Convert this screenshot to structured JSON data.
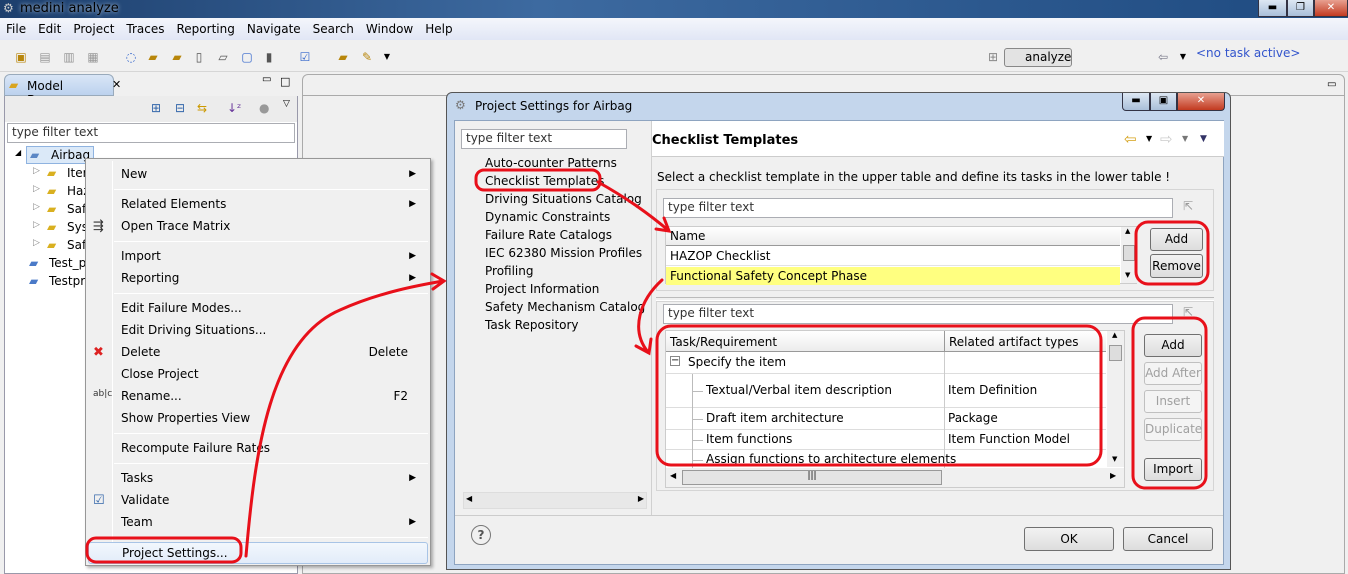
{
  "window": {
    "title": "medini analyze"
  },
  "menubar": [
    "File",
    "Edit",
    "Project",
    "Traces",
    "Reporting",
    "Navigate",
    "Search",
    "Window",
    "Help"
  ],
  "perspective": {
    "label": "analyze",
    "task": "<no task active>"
  },
  "model_browser": {
    "title": "Model Browser",
    "filter_placeholder": "type filter text",
    "tree": [
      {
        "label": "Airbag",
        "level": 0
      },
      {
        "label": "Iter",
        "level": 1
      },
      {
        "label": "Haz",
        "level": 1
      },
      {
        "label": "Saf",
        "level": 1
      },
      {
        "label": "Sys",
        "level": 1
      },
      {
        "label": "Saf",
        "level": 1
      },
      {
        "label": "Test_pr",
        "level": 0
      },
      {
        "label": "Testpro",
        "level": 0
      }
    ]
  },
  "context_menu": [
    {
      "label": "New",
      "submenu": true
    },
    {
      "sep": true
    },
    {
      "label": "Related Elements",
      "submenu": true
    },
    {
      "label": "Open Trace Matrix",
      "icon": "trace-matrix-icon"
    },
    {
      "sep": true
    },
    {
      "label": "Import",
      "submenu": true
    },
    {
      "label": "Reporting",
      "submenu": true
    },
    {
      "sep": true
    },
    {
      "label": "Edit Failure Modes..."
    },
    {
      "label": "Edit Driving Situations..."
    },
    {
      "label": "Delete",
      "shortcut": "Delete",
      "icon": "delete-icon"
    },
    {
      "label": "Close Project"
    },
    {
      "label": "Rename...",
      "shortcut": "F2",
      "icon": "rename-icon"
    },
    {
      "label": "Show Properties View"
    },
    {
      "sep": true
    },
    {
      "label": "Recompute Failure Rates"
    },
    {
      "sep": true
    },
    {
      "label": "Tasks",
      "submenu": true
    },
    {
      "label": "Validate",
      "icon": "validate-icon"
    },
    {
      "label": "Team",
      "submenu": true
    },
    {
      "sep": true
    },
    {
      "label": "Project Settings...",
      "selected": true
    }
  ],
  "dialog": {
    "title": "Project Settings for Airbag",
    "filter_placeholder": "type filter text",
    "categories": [
      "Auto-counter Patterns",
      "Checklist Templates",
      "Driving Situations Catalog",
      "Dynamic Constraints",
      "Failure Rate Catalogs",
      "IEC 62380 Mission Profiles",
      "Profiling",
      "Project Information",
      "Safety Mechanism Catalog",
      "Task Repository"
    ],
    "selected_category": "Checklist Templates",
    "page_title": "Checklist Templates",
    "description": "Select a checklist template in the upper table and define its tasks in the lower table !",
    "upper": {
      "filter_placeholder": "type filter text",
      "column": "Name",
      "rows": [
        "HAZOP Checklist",
        "Functional Safety Concept Phase"
      ],
      "selected_row": "Functional Safety Concept Phase",
      "buttons": [
        "Add",
        "Remove"
      ]
    },
    "lower": {
      "filter_placeholder": "type filter text",
      "columns": [
        "Task/Requirement",
        "Related artifact types"
      ],
      "rows": [
        {
          "task": "Specify the item",
          "artifact": "",
          "group": true
        },
        {
          "task": "Textual/Verbal item description",
          "artifact": "Item Definition"
        },
        {
          "task": "Draft item architecture",
          "artifact": "Package"
        },
        {
          "task": "Item functions",
          "artifact": "Item Function Model"
        },
        {
          "task": "Assign functions to architecture elements",
          "artifact": ""
        }
      ],
      "buttons": [
        {
          "label": "Add",
          "enabled": true
        },
        {
          "label": "Add After",
          "enabled": false
        },
        {
          "label": "Insert",
          "enabled": false
        },
        {
          "label": "Duplicate",
          "enabled": false
        },
        {
          "label": "Import",
          "enabled": true
        }
      ]
    },
    "ok": "OK",
    "cancel": "Cancel"
  },
  "colors": {
    "selection": "#ffff80",
    "annotation": "#e8101a",
    "link": "#3355cc"
  }
}
